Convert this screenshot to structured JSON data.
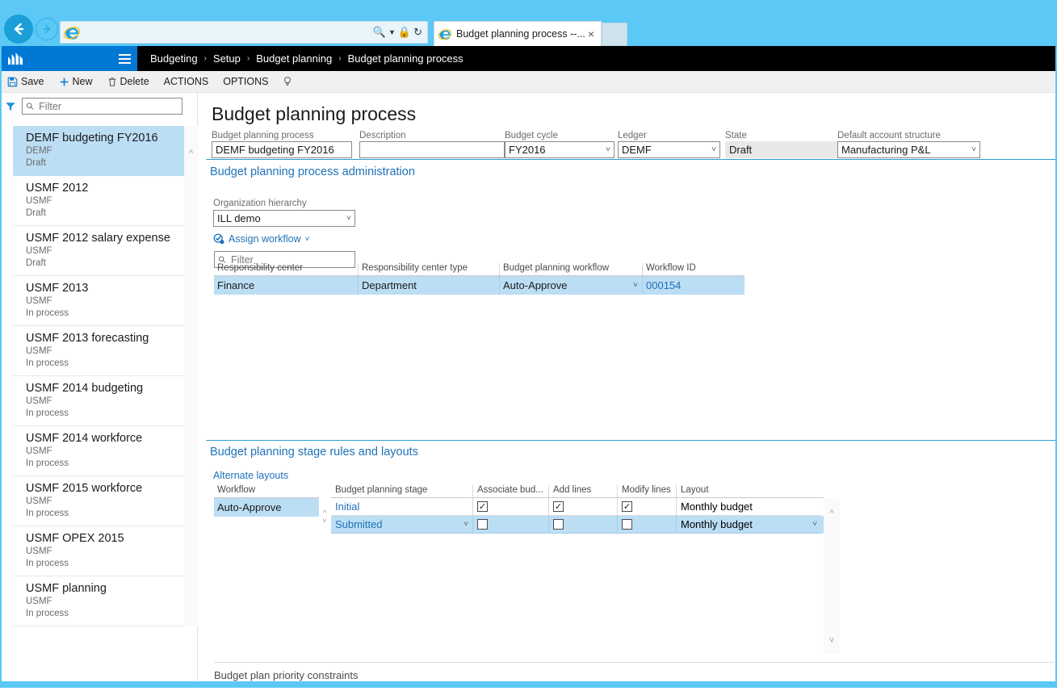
{
  "browser": {
    "back_icon": "arrow-left-icon",
    "forward_icon": "arrow-right-icon",
    "address_value": "",
    "address_placeholder": "",
    "search_icon": "search-icon",
    "lock_icon": "lock-icon",
    "refresh_icon": "refresh-icon",
    "tab_title": "Budget planning process --...",
    "tab_close": "×"
  },
  "navbar": {
    "logo": "dynamics-logo",
    "hamburger": "hamburger-icon",
    "breadcrumb": [
      "Budgeting",
      "Setup",
      "Budget planning",
      "Budget planning process"
    ],
    "separator": "›"
  },
  "actionpane": {
    "save": "Save",
    "new": "New",
    "delete": "Delete",
    "actions": "ACTIONS",
    "options": "OPTIONS",
    "help_icon": "lightbulb-icon"
  },
  "sidebar": {
    "filter_icon": "filter-icon",
    "filter_placeholder": "Filter",
    "filter_value": "",
    "scroll_up_icon": "chevron-up-icon",
    "items": [
      {
        "title": "DEMF budgeting FY2016",
        "company": "DEMF",
        "status": "Draft",
        "selected": true
      },
      {
        "title": "USMF 2012",
        "company": "USMF",
        "status": "Draft",
        "selected": false
      },
      {
        "title": "USMF 2012 salary expense",
        "company": "USMF",
        "status": "Draft",
        "selected": false
      },
      {
        "title": "USMF 2013",
        "company": "USMF",
        "status": "In process",
        "selected": false
      },
      {
        "title": "USMF 2013 forecasting",
        "company": "USMF",
        "status": "In process",
        "selected": false
      },
      {
        "title": "USMF 2014 budgeting",
        "company": "USMF",
        "status": "In process",
        "selected": false
      },
      {
        "title": "USMF 2014 workforce",
        "company": "USMF",
        "status": "In process",
        "selected": false
      },
      {
        "title": "USMF 2015 workforce",
        "company": "USMF",
        "status": "In process",
        "selected": false
      },
      {
        "title": "USMF OPEX 2015",
        "company": "USMF",
        "status": "In process",
        "selected": false
      },
      {
        "title": "USMF planning",
        "company": "USMF",
        "status": "In process",
        "selected": false
      }
    ]
  },
  "main": {
    "page_title": "Budget planning process",
    "fields": {
      "process": {
        "label": "Budget planning process",
        "value": "DEMF budgeting FY2016"
      },
      "description": {
        "label": "Description",
        "value": ""
      },
      "cycle": {
        "label": "Budget cycle",
        "value": "FY2016"
      },
      "ledger": {
        "label": "Ledger",
        "value": "DEMF"
      },
      "state": {
        "label": "State",
        "value": "Draft"
      },
      "account_structure": {
        "label": "Default account structure",
        "value": "Manufacturing P&L"
      }
    },
    "admin_section": {
      "title": "Budget planning process administration",
      "hierarchy_label": "Organization hierarchy",
      "hierarchy_value": "ILL demo",
      "assign_workflow": "Assign workflow",
      "assign_workflow_icon": "workflow-icon",
      "chevron_icon": "chevron-down-icon",
      "filter_placeholder": "Filter",
      "filter_value": "",
      "grid_headers": [
        "Responsibility center",
        "Responsibility center type",
        "Budget planning workflow",
        "Workflow ID"
      ],
      "grid_rows": [
        {
          "responsibility_center": "Finance",
          "center_type": "Department",
          "workflow": "Auto-Approve",
          "workflow_id": "000154",
          "selected": true
        }
      ]
    },
    "stage_section": {
      "title": "Budget planning stage rules and layouts",
      "alternate_layouts": "Alternate layouts",
      "workflow_header": "Workflow",
      "workflow_rows": [
        "Auto-Approve"
      ],
      "grid_headers": [
        "Budget planning stage",
        "Associate bud...",
        "Add lines",
        "Modify lines",
        "Layout"
      ],
      "grid_rows": [
        {
          "stage": "Initial",
          "associate_budget": true,
          "add_lines": true,
          "modify_lines": true,
          "layout": "Monthly budget",
          "selected": false
        },
        {
          "stage": "Submitted",
          "associate_budget": false,
          "add_lines": false,
          "modify_lines": false,
          "layout": "Monthly budget",
          "selected": true
        }
      ],
      "scroll_up_icon": "chevron-up-icon",
      "scroll_down_icon": "chevron-down-icon",
      "splitter_icon": "resize-handle-icon"
    },
    "footer_section": {
      "title": "Budget plan priority constraints"
    }
  },
  "colors": {
    "browser_chrome": "#5bc8f5",
    "brand_blue": "#0078d4",
    "navbar_black": "#000000",
    "accent_link": "#1e72b8",
    "selection": "#bcdef5",
    "section_rule": "#2a9fd6"
  }
}
